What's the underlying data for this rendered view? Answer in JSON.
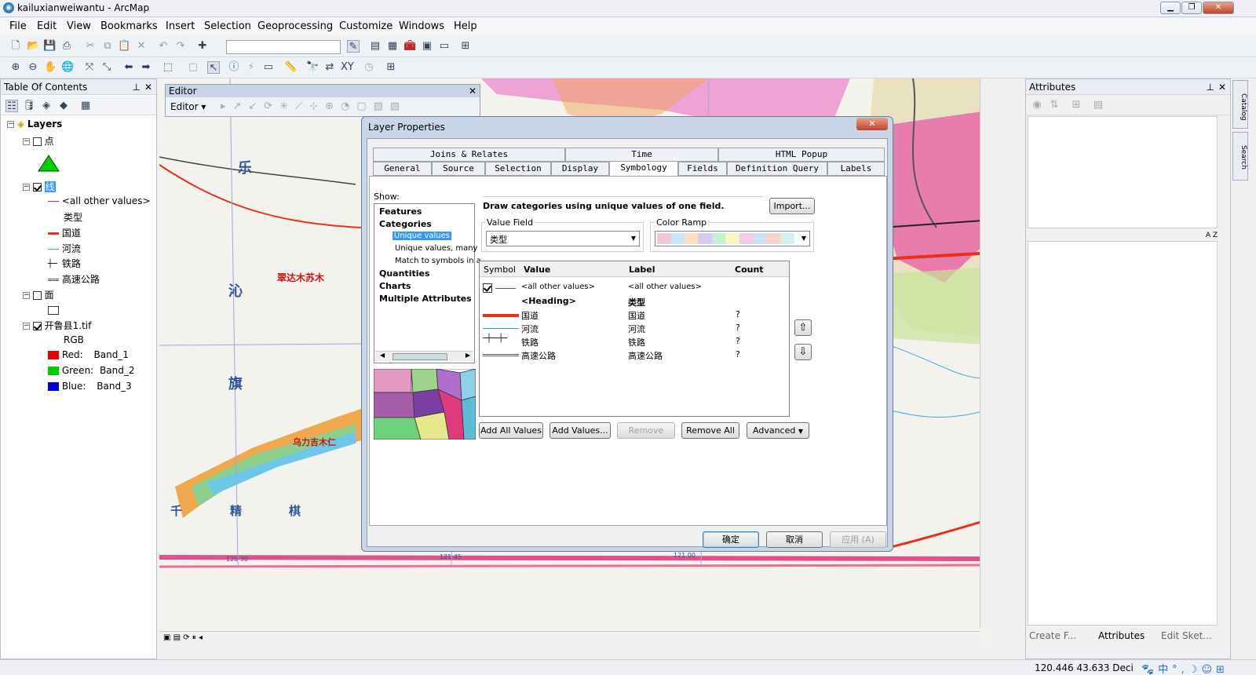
{
  "app": {
    "title": "kailuxianweiwantu - ArcMap"
  },
  "menu": [
    "File",
    "Edit",
    "View",
    "Bookmarks",
    "Insert",
    "Selection",
    "Geoprocessing",
    "Customize",
    "Windows",
    "Help"
  ],
  "toc": {
    "title": "Table Of Contents",
    "layers_label": "Layers",
    "items": {
      "point": "点",
      "line": "线",
      "all_other": "<all other values>",
      "type": "类型",
      "guodao": "国道",
      "heliu": "河流",
      "tielu": "铁路",
      "gaosu": "高速公路",
      "polygon": "面",
      "raster": "开鲁县1.tif",
      "rgb": "RGB",
      "red": "Red:",
      "green": "Green:",
      "blue": "Blue:",
      "band1": "Band_1",
      "band2": "Band_2",
      "band3": "Band_3"
    }
  },
  "editor": {
    "title": "Editor",
    "menu": "Editor ▾"
  },
  "attributes": {
    "title": "Attributes",
    "tabs": [
      "Create F...",
      "Attributes",
      "Edit Sket..."
    ],
    "side_tabs": [
      "Catalog",
      "Search"
    ]
  },
  "dialog": {
    "title": "Layer Properties",
    "tabs_row1": [
      "Joins & Relates",
      "Time",
      "HTML Popup"
    ],
    "tabs_row2": [
      "General",
      "Source",
      "Selection",
      "Display",
      "Symbology",
      "Fields",
      "Definition Query",
      "Labels"
    ],
    "show_label": "Show:",
    "show_items": [
      "Features",
      "Categories",
      "Unique values",
      "Unique values, many",
      "Match to symbols in a",
      "Quantities",
      "Charts",
      "Multiple Attributes"
    ],
    "description": "Draw categories using unique values of one field.",
    "import_button": "Import...",
    "value_field_label": "Value Field",
    "value_field": "类型",
    "color_ramp_label": "Color Ramp",
    "columns": [
      "Symbol",
      "Value",
      "Label",
      "Count"
    ],
    "rows": [
      {
        "value": "<all other values>",
        "label": "<all other values>",
        "count": ""
      },
      {
        "value": "<Heading>",
        "label": "类型",
        "count": ""
      },
      {
        "value": "国道",
        "label": "国道",
        "count": "?"
      },
      {
        "value": "河流",
        "label": "河流",
        "count": "?"
      },
      {
        "value": "铁路",
        "label": "铁路",
        "count": "?"
      },
      {
        "value": "高速公路",
        "label": "高速公路",
        "count": "?"
      }
    ],
    "buttons": {
      "add_all": "Add All Values",
      "add": "Add Values...",
      "remove": "Remove",
      "remove_all": "Remove All",
      "advanced": "Advanced"
    },
    "ok": "确定",
    "cancel": "取消",
    "apply": "应用 (A)"
  },
  "map_labels": {
    "a": "乐",
    "b": "沁",
    "c": "旗",
    "d": "千",
    "e": "精",
    "f": "棋",
    "g": "翠达木苏木",
    "h": "乌力吉木仁",
    "coord1": "120 30",
    "coord2": "121 45",
    "coord3": "121 00"
  },
  "status": {
    "coords": "120.446  43.633 Deci"
  },
  "colors": {
    "guodao": "#e8301c",
    "heliu": "#36a9e0",
    "pink": "#e34f8b",
    "accent": "#3399ff"
  }
}
